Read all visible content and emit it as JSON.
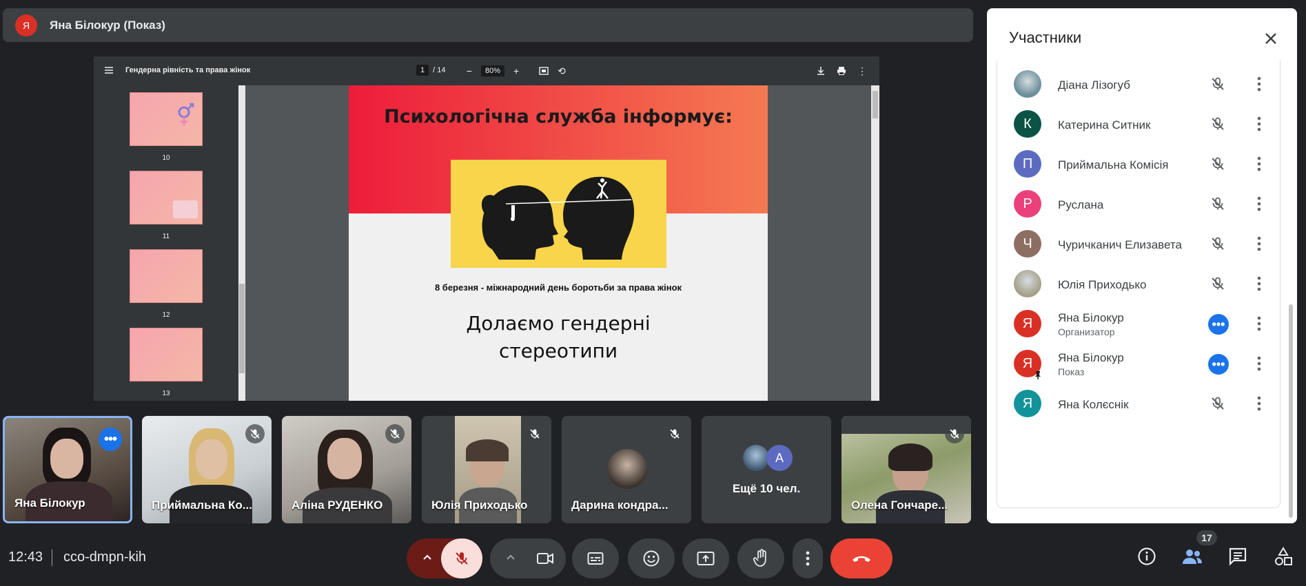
{
  "presenter": {
    "avatar_letter": "Я",
    "title": "Яна Білокур (Показ)"
  },
  "pdf": {
    "title": "Гендерна рівність та права жінок",
    "page_current": "1",
    "page_total": "/ 14",
    "zoom": "80%",
    "thumbnails": [
      "10",
      "11",
      "12",
      "13"
    ],
    "slide_heading": "Психологічна служба інформує:",
    "slide_date": "8 березня - міжнародний день боротьби за права жінок",
    "slide_subtitle_line1": "Долаємо гендерні",
    "slide_subtitle_line2": "стереотипи"
  },
  "tiles": [
    {
      "name": "Яна Білокур",
      "state": "more"
    },
    {
      "name": "Приймальна Ко...",
      "state": "muted"
    },
    {
      "name": "Аліна РУДЕНКО",
      "state": "muted"
    },
    {
      "name": "Юлія Приходько",
      "state": "muted"
    },
    {
      "name": "Дарина кондра...",
      "state": "muted"
    },
    {
      "name": "Ещё 10 чел.",
      "avatar_letter": "А"
    },
    {
      "name": "Олена Гончаре...",
      "state": "muted"
    }
  ],
  "bottom": {
    "time": "12:43",
    "meeting_code": "cco-dmpn-kih",
    "participant_count": "17"
  },
  "panel": {
    "title": "Участники",
    "participants": [
      {
        "name": "Діана Лізогуб",
        "letter": "",
        "color": "#6b8e9b",
        "role": "",
        "status": "muted"
      },
      {
        "name": "Катерина Ситник",
        "letter": "К",
        "color": "#0b5345",
        "role": "",
        "status": "muted"
      },
      {
        "name": "Приймальна Комісія",
        "letter": "П",
        "color": "#5c6bc0",
        "role": "",
        "status": "muted"
      },
      {
        "name": "Руслана",
        "letter": "Р",
        "color": "#ec407a",
        "role": "",
        "status": "muted"
      },
      {
        "name": "Чуричканич Елизавета",
        "letter": "Ч",
        "color": "#8d6e63",
        "role": "",
        "status": "muted"
      },
      {
        "name": "Юлія Приходько",
        "letter": "",
        "color": "#a5a08a",
        "role": "",
        "status": "muted"
      },
      {
        "name": "Яна Білокур",
        "letter": "Я",
        "color": "#d93025",
        "role": "Организатор",
        "status": "speaking"
      },
      {
        "name": "Яна Білокур",
        "letter": "Я",
        "color": "#d93025",
        "role": "Показ",
        "status": "speaking"
      },
      {
        "name": "Яна Колєснік",
        "letter": "Я",
        "color": "#12939a",
        "role": "",
        "status": "muted"
      }
    ]
  },
  "colors": {
    "end_call": "#ea4335",
    "mic_off": "#f9dedc",
    "accent": "#1a73e8"
  }
}
